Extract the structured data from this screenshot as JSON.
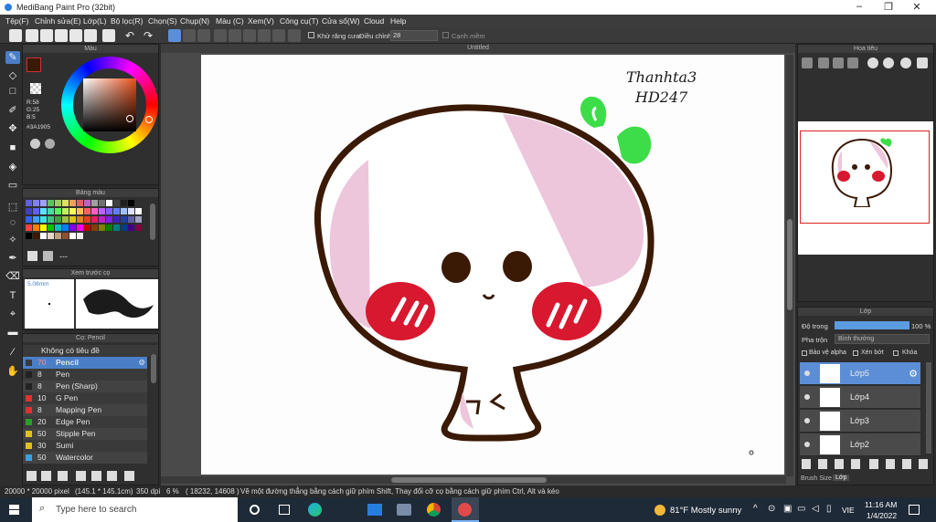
{
  "app": {
    "title": "MediBang Paint Pro (32bit)",
    "canvas_tab": "Untitled"
  },
  "menu": [
    "Tệp(F)",
    "Chỉnh sửa(E)",
    "Lớp(L)",
    "Bộ lọc(R)",
    "Chọn(S)",
    "Chụp(N)",
    "Màu (C)",
    "Xem(V)",
    "Công cụ(T)",
    "Cửa sổ(W)",
    "Cloud",
    "Help"
  ],
  "toolbar": {
    "antialias_label": "Khử răng cưa",
    "adjust_label": "Điều chỉnh",
    "adjust_value": "28",
    "corner_label": "Cạnh mềm"
  },
  "color_panel": {
    "title": "Màu",
    "r": "R:58",
    "g": "G:25",
    "b": "B:5",
    "hex": "#3A1905",
    "current_color": "#3a1905"
  },
  "palette_panel": {
    "title": "Bảng màu",
    "dash": "---"
  },
  "preview_panel": {
    "title": "Xem trước cọ",
    "size": "5.08mm"
  },
  "brush_panel": {
    "title": "Cọ: Pencil",
    "group": "Không có tiêu đề",
    "brushes": [
      {
        "size": "70",
        "name": "Pencil",
        "color": "#3a3a3a",
        "selected": true
      },
      {
        "size": "8",
        "name": "Pen",
        "color": "#222222"
      },
      {
        "size": "8",
        "name": "Pen (Sharp)",
        "color": "#222222"
      },
      {
        "size": "10",
        "name": "G Pen",
        "color": "#e03030"
      },
      {
        "size": "8",
        "name": "Mapping Pen",
        "color": "#e03030"
      },
      {
        "size": "20",
        "name": "Edge Pen",
        "color": "#2aa02a"
      },
      {
        "size": "50",
        "name": "Stipple Pen",
        "color": "#e0c020"
      },
      {
        "size": "30",
        "name": "Sumi",
        "color": "#e0c020"
      },
      {
        "size": "50",
        "name": "Watercolor",
        "color": "#3aa0e0"
      }
    ]
  },
  "navigator": {
    "title": "Hoa tiêu"
  },
  "layers_panel": {
    "title": "Lớp",
    "opacity_label": "Độ trong",
    "opacity_value": "100 %",
    "blend_label": "Pha trộn",
    "blend_value": "Bình thường",
    "protect_alpha": "Bảo vệ alpha",
    "clip": "Xén bớt",
    "lock": "Khóa",
    "layers": [
      {
        "name": "Lớp5",
        "selected": true
      },
      {
        "name": "Lớp4"
      },
      {
        "name": "Lớp3"
      },
      {
        "name": "Lớp2"
      }
    ],
    "tabs": [
      "Brush Size",
      "Lớp"
    ]
  },
  "artwork": {
    "signature_line1": "Thanhta3",
    "signature_line2": "HD247"
  },
  "status": {
    "size": "20000 * 20000 pixel",
    "cm": "(145.1 * 145.1cm)",
    "dpi": "350 dpi",
    "zoom": "6 %",
    "coords": "( 18232, 14608 )",
    "hint": "Vẽ một đường thẳng bằng cách giữ phím Shift, Thay đổi cỡ cọ bằng cách giữ phím Ctrl, Alt và kéo"
  },
  "taskbar": {
    "search_placeholder": "Type here to search",
    "weather": "81°F  Mostly sunny",
    "lang": "VIE",
    "time": "11:16 AM",
    "date": "1/4/2022"
  },
  "colors": {
    "accent": "#4a7fc8",
    "face_fill": "#edc6dc",
    "outline": "#3a1905",
    "leaf": "#3ddd4a",
    "cheek": "#d8182e"
  }
}
